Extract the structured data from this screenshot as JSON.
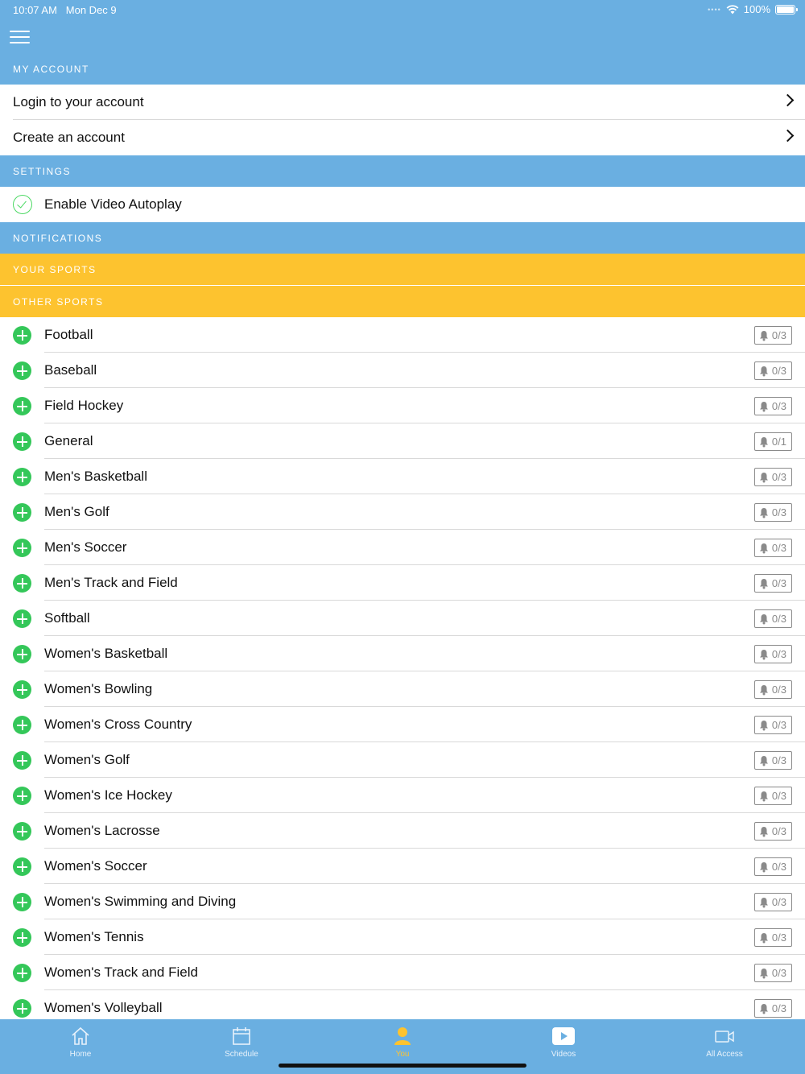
{
  "status_bar": {
    "time": "10:07 AM",
    "date": "Mon Dec 9",
    "battery": "100%"
  },
  "sections": {
    "my_account": "MY ACCOUNT",
    "settings": "SETTINGS",
    "notifications": "NOTIFICATIONS",
    "your_sports": "YOUR SPORTS",
    "other_sports": "OTHER SPORTS"
  },
  "account": {
    "login": "Login to your account",
    "create": "Create an account"
  },
  "settings": {
    "autoplay": "Enable Video Autoplay"
  },
  "sports": [
    {
      "name": "Football",
      "count": "0/3"
    },
    {
      "name": "Baseball",
      "count": "0/3"
    },
    {
      "name": "Field Hockey",
      "count": "0/3"
    },
    {
      "name": "General",
      "count": "0/1"
    },
    {
      "name": "Men's Basketball",
      "count": "0/3"
    },
    {
      "name": "Men's Golf",
      "count": "0/3"
    },
    {
      "name": "Men's Soccer",
      "count": "0/3"
    },
    {
      "name": "Men's Track and Field",
      "count": "0/3"
    },
    {
      "name": "Softball",
      "count": "0/3"
    },
    {
      "name": "Women's Basketball",
      "count": "0/3"
    },
    {
      "name": "Women's Bowling",
      "count": "0/3"
    },
    {
      "name": "Women's Cross Country",
      "count": "0/3"
    },
    {
      "name": "Women's Golf",
      "count": "0/3"
    },
    {
      "name": "Women's Ice Hockey",
      "count": "0/3"
    },
    {
      "name": "Women's Lacrosse",
      "count": "0/3"
    },
    {
      "name": "Women's Soccer",
      "count": "0/3"
    },
    {
      "name": "Women's Swimming and Diving",
      "count": "0/3"
    },
    {
      "name": "Women's Tennis",
      "count": "0/3"
    },
    {
      "name": "Women's Track and Field",
      "count": "0/3"
    },
    {
      "name": "Women's Volleyball",
      "count": "0/3"
    }
  ],
  "tabs": [
    {
      "label": "Home",
      "icon": "home-icon"
    },
    {
      "label": "Schedule",
      "icon": "calendar-icon"
    },
    {
      "label": "You",
      "icon": "person-icon"
    },
    {
      "label": "Videos",
      "icon": "play-icon"
    },
    {
      "label": "All Access",
      "icon": "video-camera-icon"
    }
  ],
  "colors": {
    "header_blue": "#6aafe1",
    "header_yellow": "#fdc32f",
    "add_green": "#34c759",
    "active_tab": "#fdc32f"
  }
}
